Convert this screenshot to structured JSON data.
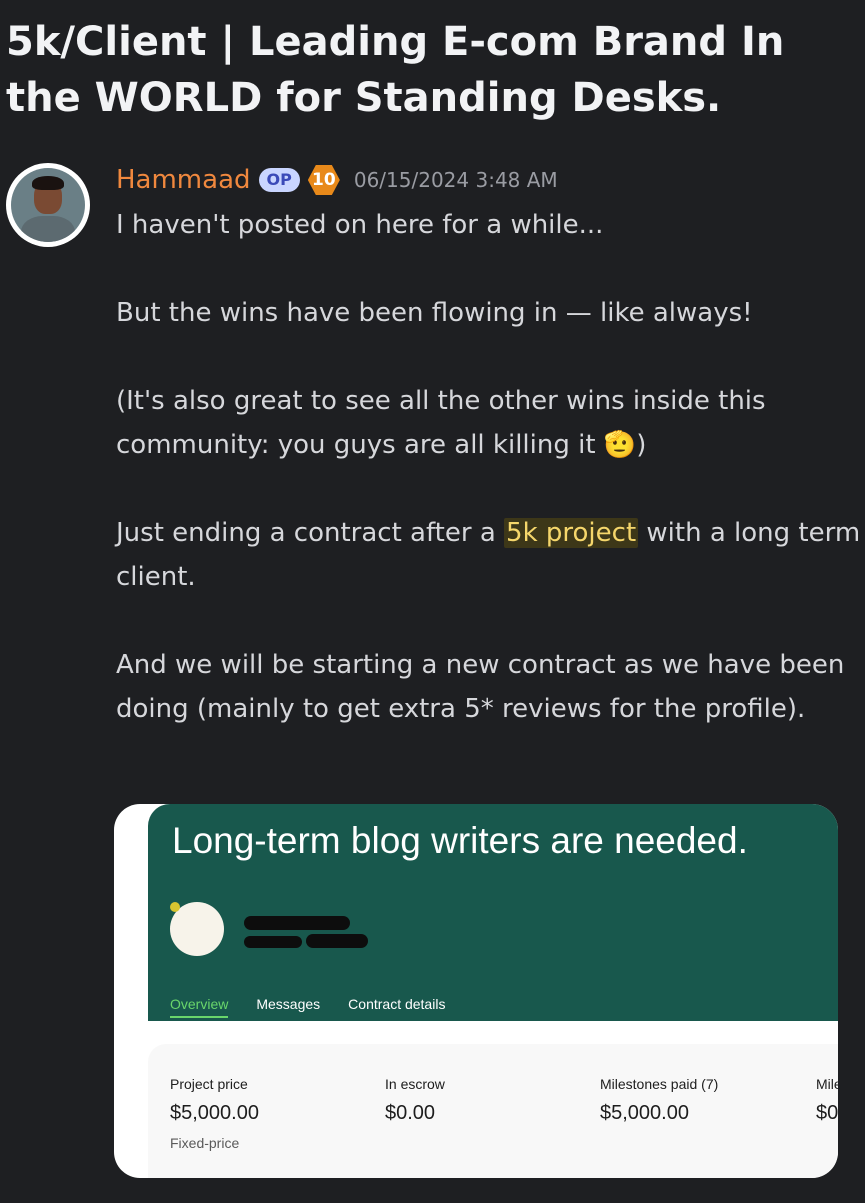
{
  "post": {
    "title": "5k/Client | Leading E-com Brand In the WORLD for Standing Desks."
  },
  "author": {
    "name": "Hammaad",
    "op_badge": "OP",
    "level": "10",
    "timestamp": "06/15/2024 3:48 AM"
  },
  "message": {
    "p1": "I haven't posted on here for a while...",
    "p2": "But the wins have been flowing in — like always!",
    "p3": "(It's also great to see all the other wins inside this community: you guys are all killing it ",
    "p3_emoji": "🫡",
    "p3_end": ")",
    "p4_before": "Just ending a contract after a ",
    "p4_highlight": "5k project",
    "p4_after": " with a long term client.",
    "p5": "And we will be starting a new contract as we have been doing (mainly to get extra 5* reviews for the profile)."
  },
  "embed": {
    "job_title": "Long-term blog writers are needed.",
    "tabs": [
      "Overview",
      "Messages",
      "Contract details"
    ],
    "stats": [
      {
        "label": "Project price",
        "value": "$5,000.00",
        "sub": "Fixed-price"
      },
      {
        "label": "In escrow",
        "value": "$0.00"
      },
      {
        "label": "Milestones paid (7)",
        "value": "$5,000.00"
      },
      {
        "label": "Mile",
        "value": "$0"
      }
    ],
    "colors": {
      "header": "#18584d",
      "active_tab": "#69d66b"
    }
  }
}
